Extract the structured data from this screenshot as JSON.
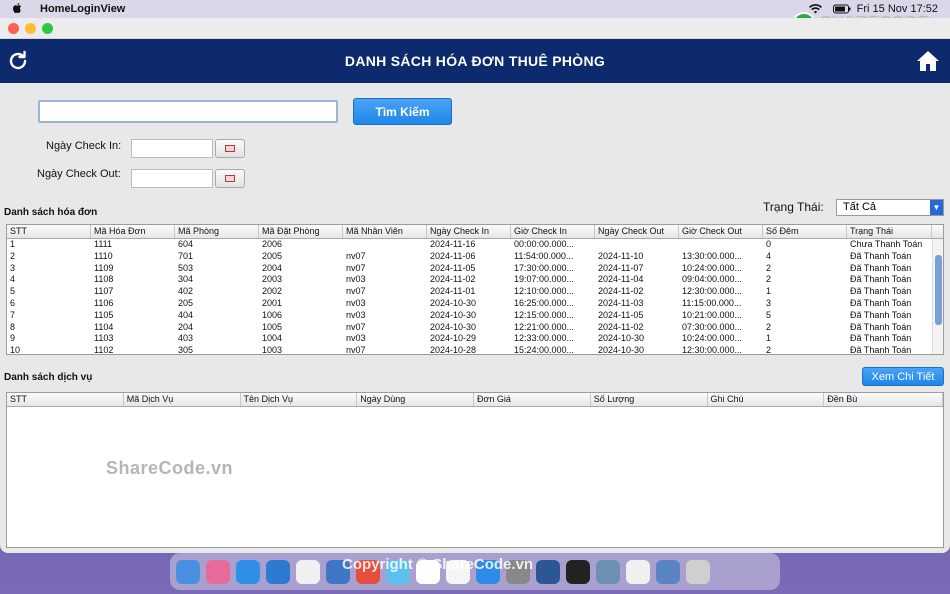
{
  "menubar": {
    "apple": "",
    "app_name": "HomeLoginView",
    "datetime": "Fri 15 Nov  17:52"
  },
  "logo": {
    "text": "SHARECODE.vn"
  },
  "header": {
    "title": "DANH SÁCH HÓA ĐƠN THUÊ PHÒNG"
  },
  "search": {
    "button": "Tìm Kiếm",
    "value": ""
  },
  "filters": {
    "checkin_label": "Ngày Check In:",
    "checkout_label": "Ngày Check Out:",
    "status_label": "Trạng Thái:",
    "status_value": "Tất Cả"
  },
  "invoices": {
    "section_label": "Danh sách hóa đơn",
    "columns": [
      "STT",
      "Mã Hóa Đơn",
      "Mã Phòng",
      "Mã Đặt Phòng",
      "Mã Nhân Viên",
      "Ngày Check In",
      "Giờ Check In",
      "Ngày Check Out",
      "Giờ Check Out",
      "Số Đêm",
      "Trạng Thái"
    ],
    "rows": [
      [
        "1",
        "1111",
        "604",
        "2006",
        "",
        "2024-11-16",
        "00:00:00.000...",
        "",
        "",
        "0",
        "Chưa Thanh Toán"
      ],
      [
        "2",
        "1110",
        "701",
        "2005",
        "nv07",
        "2024-11-06",
        "11:54:00.000...",
        "2024-11-10",
        "13:30:00.000...",
        "4",
        "Đã Thanh Toán"
      ],
      [
        "3",
        "1109",
        "503",
        "2004",
        "nv07",
        "2024-11-05",
        "17:30:00.000...",
        "2024-11-07",
        "10:24:00.000...",
        "2",
        "Đã Thanh Toán"
      ],
      [
        "4",
        "1108",
        "304",
        "2003",
        "nv03",
        "2024-11-02",
        "19:07:00.000...",
        "2024-11-04",
        "09:04:00.000...",
        "2",
        "Đã Thanh Toán"
      ],
      [
        "5",
        "1107",
        "402",
        "2002",
        "nv07",
        "2024-11-01",
        "12:10:00.000...",
        "2024-11-02",
        "12:30:00.000...",
        "1",
        "Đã Thanh Toán"
      ],
      [
        "6",
        "1106",
        "205",
        "2001",
        "nv03",
        "2024-10-30",
        "16:25:00.000...",
        "2024-11-03",
        "11:15:00.000...",
        "3",
        "Đã Thanh Toán"
      ],
      [
        "7",
        "1105",
        "404",
        "1006",
        "nv03",
        "2024-10-30",
        "12:15:00.000...",
        "2024-11-05",
        "10:21:00.000...",
        "5",
        "Đã Thanh Toán"
      ],
      [
        "8",
        "1104",
        "204",
        "1005",
        "nv07",
        "2024-10-30",
        "12:21:00.000...",
        "2024-11-02",
        "07:30:00.000...",
        "2",
        "Đã Thanh Toán"
      ],
      [
        "9",
        "1103",
        "403",
        "1004",
        "nv03",
        "2024-10-29",
        "12:33:00.000...",
        "2024-10-30",
        "10:24:00.000...",
        "1",
        "Đã Thanh Toán"
      ],
      [
        "10",
        "1102",
        "305",
        "1003",
        "nv07",
        "2024-10-28",
        "15:24:00.000...",
        "2024-10-30",
        "12:30:00.000...",
        "2",
        "Đã Thanh Toán"
      ]
    ]
  },
  "services": {
    "section_label": "Danh sách dịch vụ",
    "detail_button": "Xem Chi Tiết",
    "columns": [
      "STT",
      "Mã Dịch Vụ",
      "Tên Dịch Vụ",
      "Ngày Dùng",
      "Đơn Giá",
      "Số Lượng",
      "Ghi Chú",
      "Đền Bù"
    ]
  },
  "watermark": "ShareCode.vn",
  "copyright": "Copyright © ShareCode.vn",
  "colors": {
    "header_bg": "#0e2a6e",
    "button": "#1e86ea",
    "window_bg": "#e8e8e8"
  }
}
